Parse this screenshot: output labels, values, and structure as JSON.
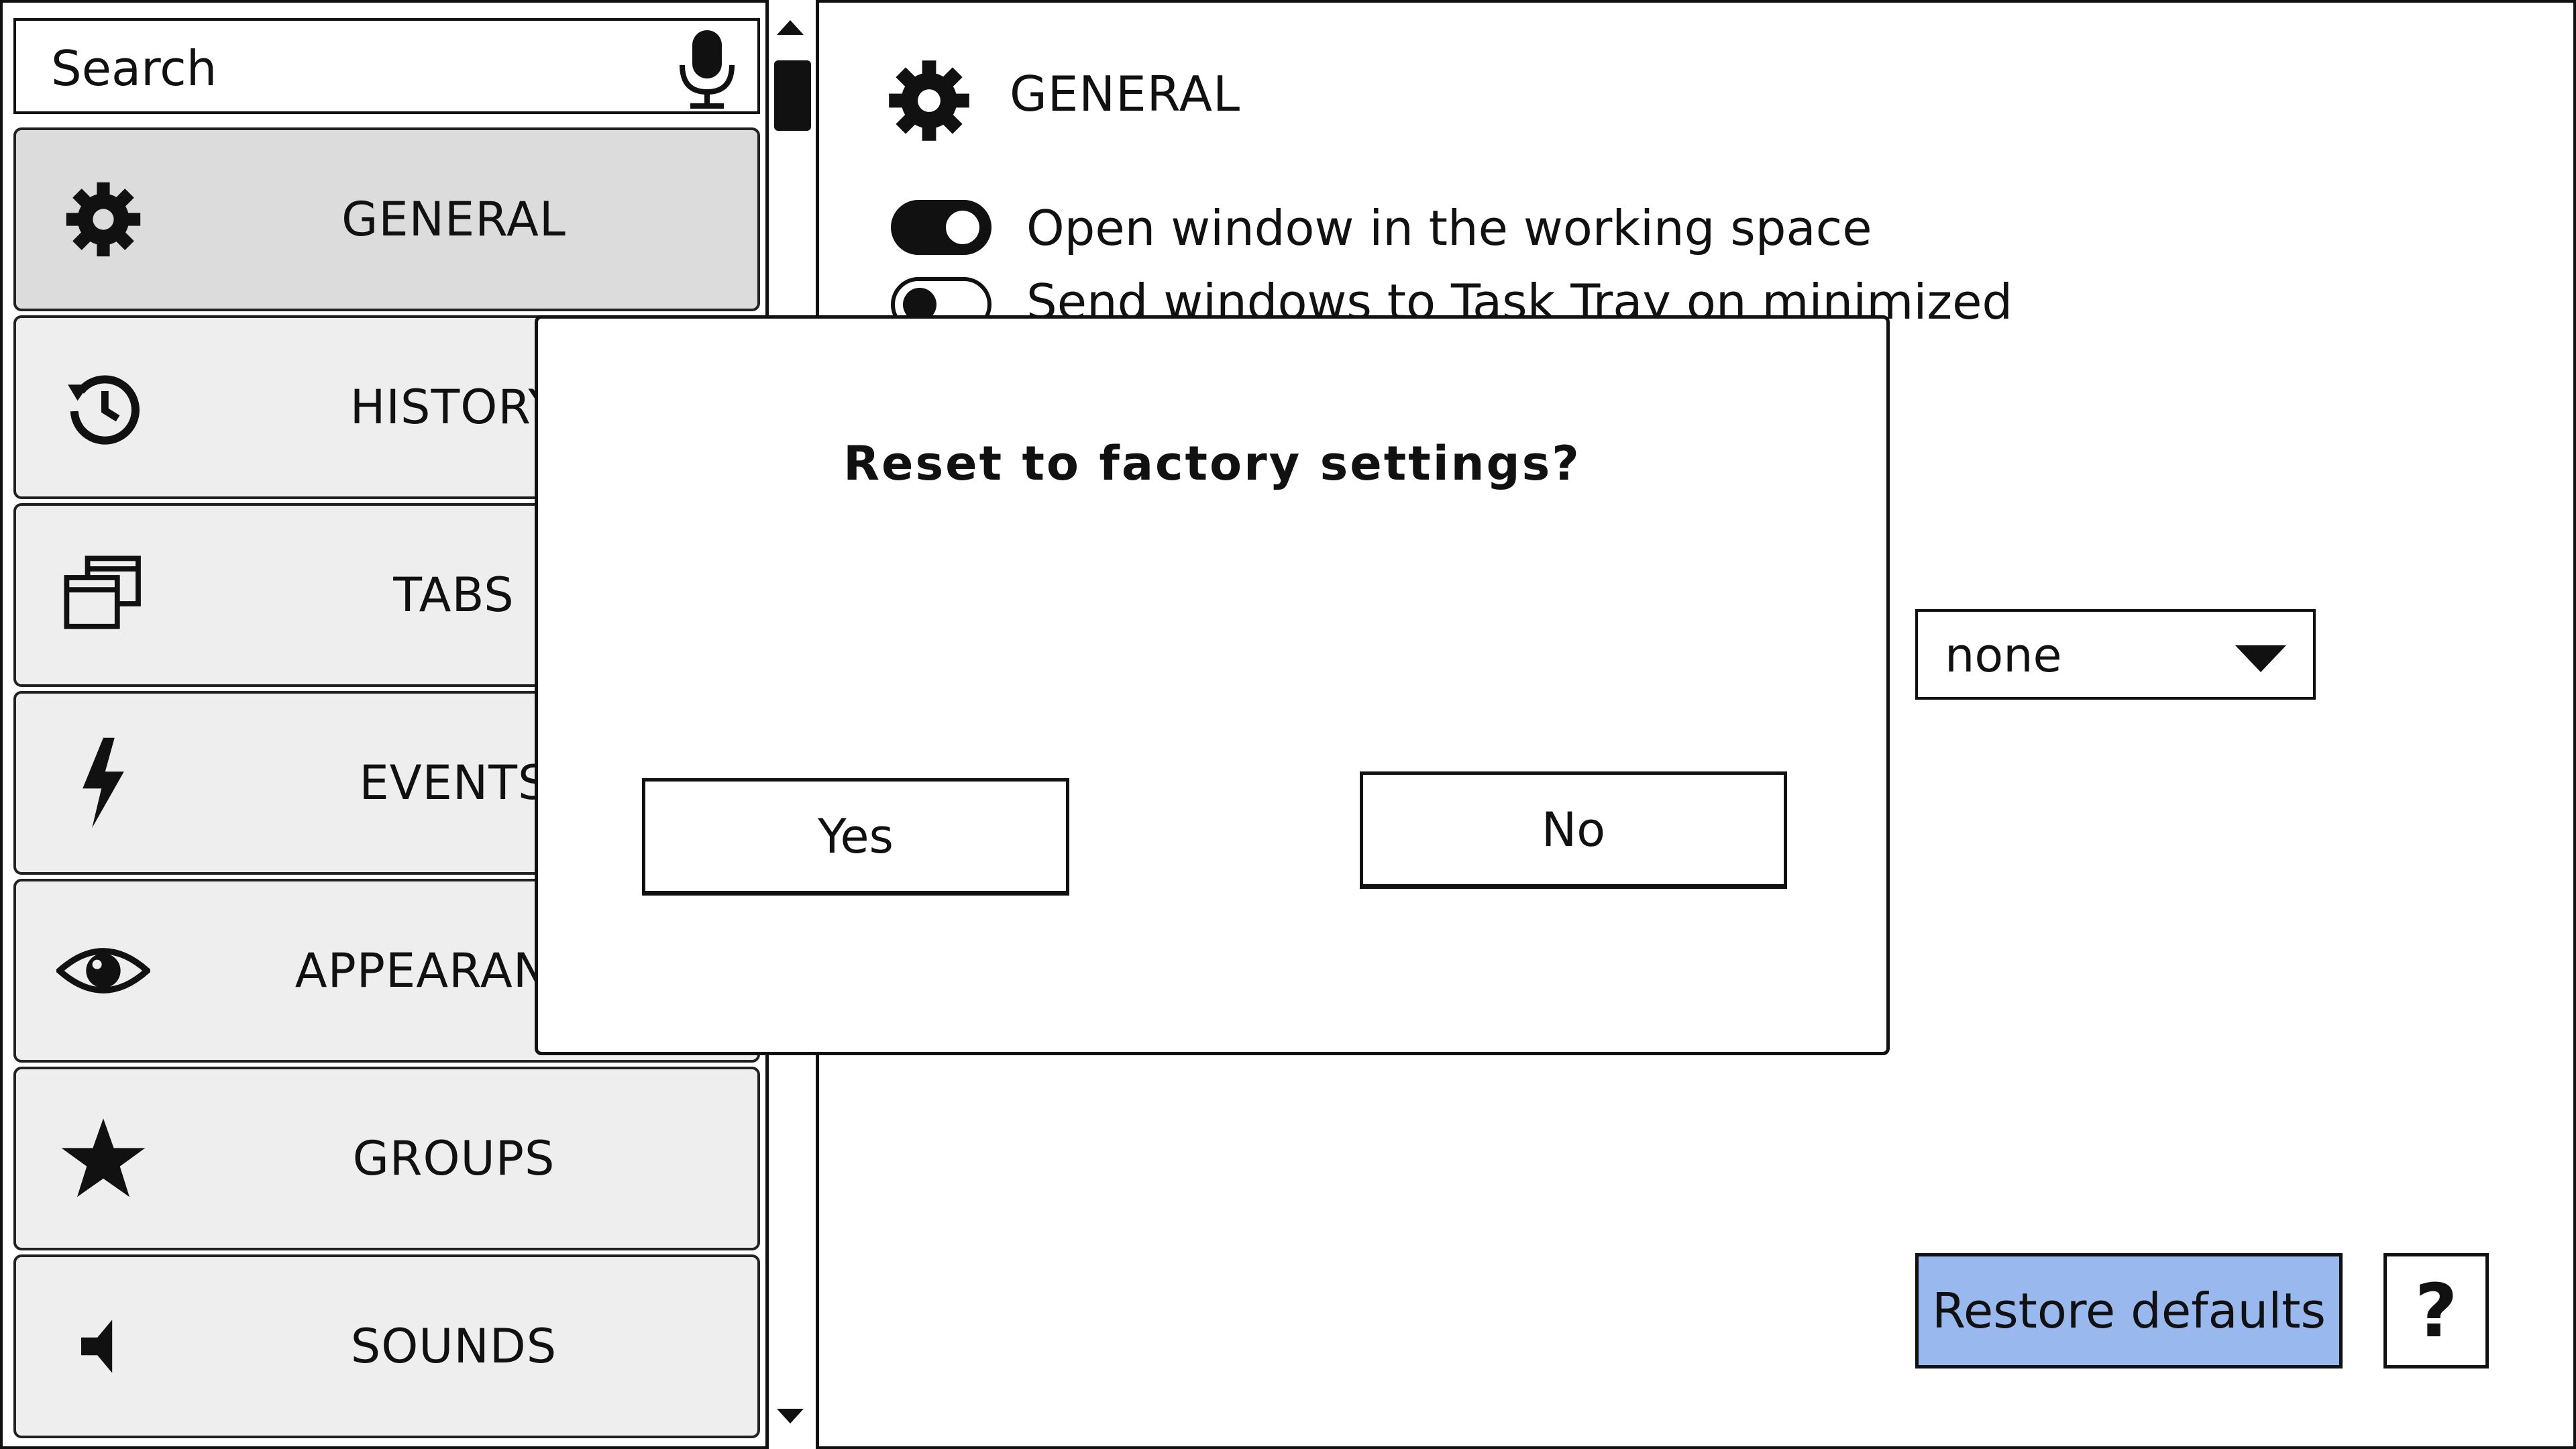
{
  "search": {
    "placeholder": "Search",
    "icon": "microphone-icon"
  },
  "sidebar": {
    "items": [
      {
        "label": "GENERAL",
        "icon": "gear-icon",
        "active": true
      },
      {
        "label": "HISTORY",
        "icon": "history-icon"
      },
      {
        "label": "TABS",
        "icon": "windows-icon"
      },
      {
        "label": "EVENTS",
        "icon": "lightning-icon"
      },
      {
        "label": "APPEARANCE",
        "icon": "eye-icon"
      },
      {
        "label": "GROUPS",
        "icon": "star-icon"
      },
      {
        "label": "SOUNDS",
        "icon": "speaker-icon"
      }
    ]
  },
  "main": {
    "title": "GENERAL",
    "title_icon": "gear-icon",
    "options": [
      {
        "label": "Open window in the working space",
        "enabled": true
      },
      {
        "label": "Send windows to Task Tray on minimized",
        "enabled": false
      }
    ],
    "dropdown": {
      "value": "none"
    },
    "restore_label": "Restore defaults",
    "help_label": "?",
    "accent_color": "#98b8ee"
  },
  "dialog": {
    "title": "Reset to factory settings?",
    "yes_label": "Yes",
    "no_label": "No"
  }
}
